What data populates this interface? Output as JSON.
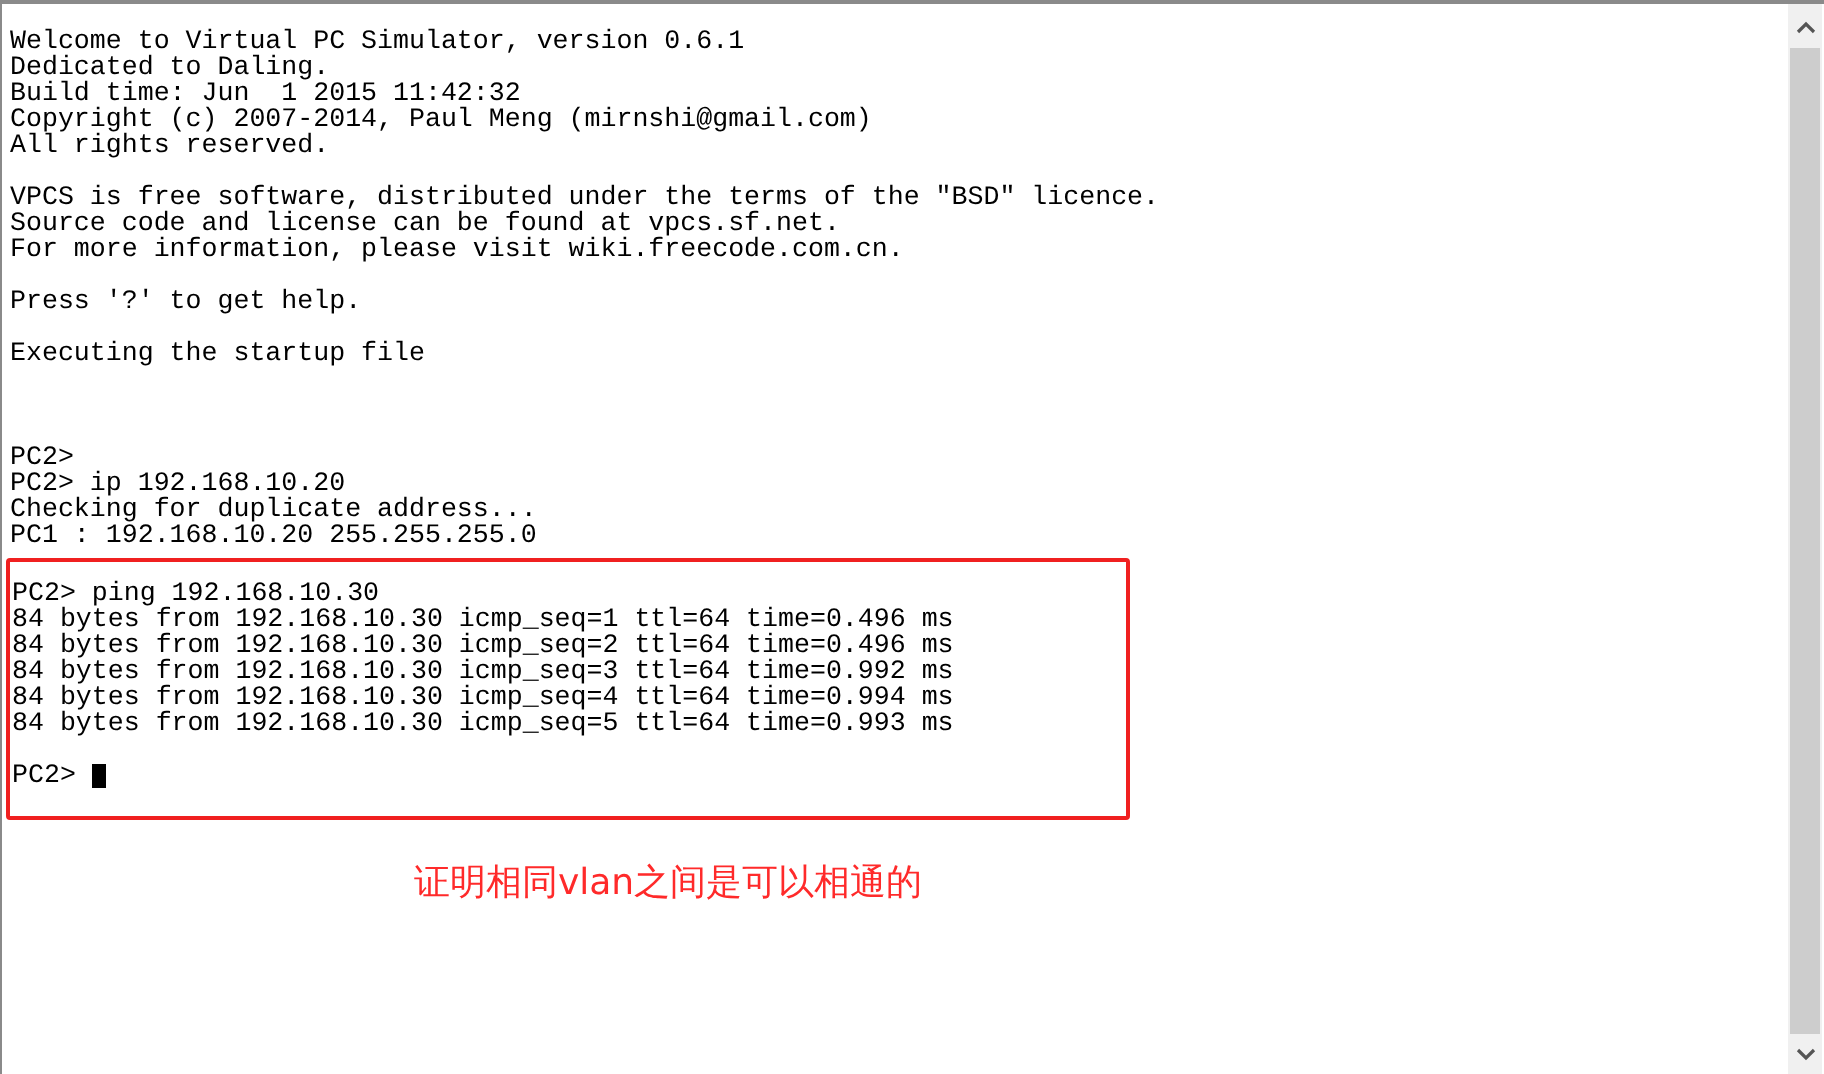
{
  "terminal": {
    "blocks": [
      [
        "Welcome to Virtual PC Simulator, version 0.6.1",
        "Dedicated to Daling.",
        "Build time: Jun  1 2015 11:42:32",
        "Copyright (c) 2007-2014, Paul Meng (mirnshi@gmail.com)",
        "All rights reserved."
      ],
      [
        "VPCS is free software, distributed under the terms of the \"BSD\" licence.",
        "Source code and license can be found at vpcs.sf.net.",
        "For more information, please visit wiki.freecode.com.cn."
      ],
      [
        "Press '?' to get help."
      ],
      [
        "Executing the startup file"
      ],
      [
        "PC2>",
        "PC2> ip 192.168.10.20",
        "Checking for duplicate address...",
        "PC1 : 192.168.10.20 255.255.255.0"
      ]
    ],
    "highlighted_block": [
      "PC2> ping 192.168.10.30",
      "84 bytes from 192.168.10.30 icmp_seq=1 ttl=64 time=0.496 ms",
      "84 bytes from 192.168.10.30 icmp_seq=2 ttl=64 time=0.496 ms",
      "84 bytes from 192.168.10.30 icmp_seq=3 ttl=64 time=0.992 ms",
      "84 bytes from 192.168.10.30 icmp_seq=4 ttl=64 time=0.994 ms",
      "84 bytes from 192.168.10.30 icmp_seq=5 ttl=64 time=0.993 ms"
    ],
    "prompt": "PC2>"
  },
  "annotation": "证明相同vlan之间是可以相通的"
}
